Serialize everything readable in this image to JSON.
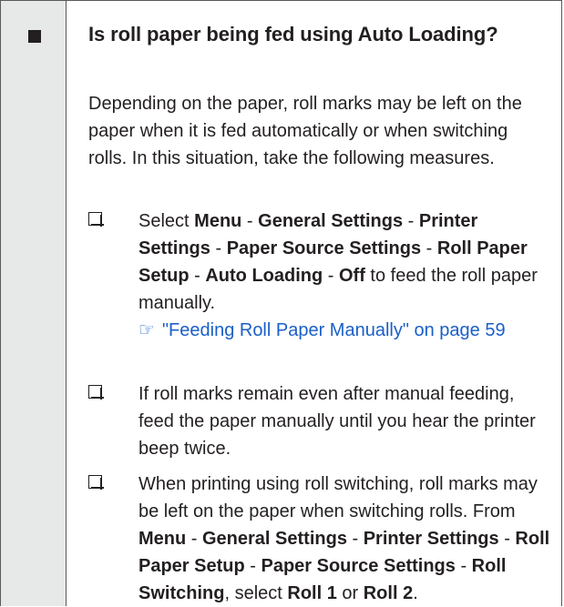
{
  "heading": "Is roll paper being fed using Auto Loading?",
  "intro": "Depending on the paper, roll marks may be left on the paper when it is fed automatically or when switching rolls. In this situation, take the following measures.",
  "item1": {
    "select": "Select",
    "menu": "Menu",
    "sep": " - ",
    "general_settings": "General Settings",
    "printer_settings": "Printer Settings",
    "paper_source_settings": "Paper Source Settings",
    "roll_paper_setup": "Roll Paper Setup",
    "auto_loading": "Auto Loading",
    "off": "Off",
    "tail": " to feed the roll paper manually.",
    "link_icon": "pointer-icon",
    "link_text": "\"Feeding Roll Paper Manually\" on page 59"
  },
  "item2": {
    "text": "If roll marks remain even after manual feeding, feed the paper manually until you hear the printer beep twice."
  },
  "item3": {
    "lead": "When printing using roll switching, roll marks may be left on the paper when switching rolls. From ",
    "menu": "Menu",
    "general_settings": "General Settings",
    "printer_settings": "Printer Settings",
    "roll_paper_setup": "Roll Paper Setup",
    "paper_source_settings": "Paper Source Settings",
    "roll_switching": "Roll Switching",
    "select": ", select ",
    "roll1": "Roll 1",
    "or": " or ",
    "roll2": "Roll 2",
    "end": "."
  }
}
